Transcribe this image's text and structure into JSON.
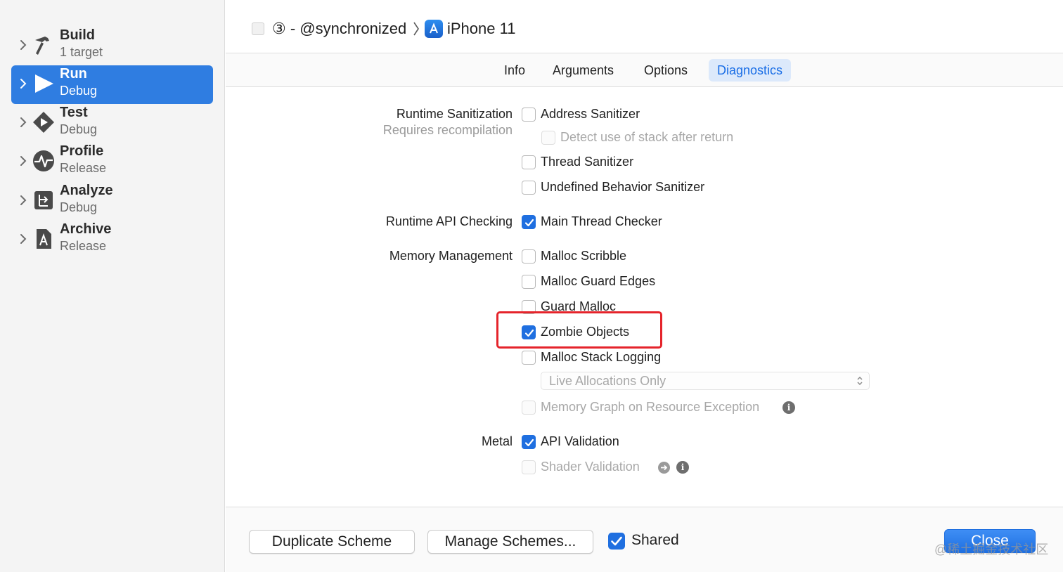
{
  "sidebar": {
    "items": [
      {
        "title": "Build",
        "subtitle": "1 target",
        "icon": "hammer-icon",
        "selected": false
      },
      {
        "title": "Run",
        "subtitle": "Debug",
        "icon": "play-icon",
        "selected": true
      },
      {
        "title": "Test",
        "subtitle": "Debug",
        "icon": "test-diamond-icon",
        "selected": false
      },
      {
        "title": "Profile",
        "subtitle": "Release",
        "icon": "waveform-icon",
        "selected": false
      },
      {
        "title": "Analyze",
        "subtitle": "Debug",
        "icon": "analyze-icon",
        "selected": false
      },
      {
        "title": "Archive",
        "subtitle": "Release",
        "icon": "archive-icon",
        "selected": false
      }
    ]
  },
  "header": {
    "project": "③ - @synchronized",
    "device": "iPhone 11"
  },
  "tabs": [
    {
      "label": "Info",
      "active": false
    },
    {
      "label": "Arguments",
      "active": false
    },
    {
      "label": "Options",
      "active": false
    },
    {
      "label": "Diagnostics",
      "active": true
    }
  ],
  "sections": {
    "runtime_sanitization": {
      "label": "Runtime Sanitization",
      "sublabel": "Requires recompilation",
      "options": [
        {
          "label": "Address Sanitizer",
          "checked": false,
          "disabled": false
        },
        {
          "label": "Detect use of stack after return",
          "checked": false,
          "disabled": true
        },
        {
          "label": "Thread Sanitizer",
          "checked": false,
          "disabled": false
        },
        {
          "label": "Undefined Behavior Sanitizer",
          "checked": false,
          "disabled": false
        }
      ]
    },
    "runtime_api": {
      "label": "Runtime API Checking",
      "options": [
        {
          "label": "Main Thread Checker",
          "checked": true,
          "disabled": false
        }
      ]
    },
    "memory": {
      "label": "Memory Management",
      "options": [
        {
          "label": "Malloc Scribble",
          "checked": false,
          "disabled": false
        },
        {
          "label": "Malloc Guard Edges",
          "checked": false,
          "disabled": false
        },
        {
          "label": "Guard Malloc",
          "checked": false,
          "disabled": false
        },
        {
          "label": "Zombie Objects",
          "checked": true,
          "disabled": false
        },
        {
          "label": "Malloc Stack Logging",
          "checked": false,
          "disabled": false
        }
      ],
      "stack_logging_mode": "Live Allocations Only",
      "memory_graph": {
        "label": "Memory Graph on Resource Exception",
        "checked": false,
        "disabled": true
      }
    },
    "metal": {
      "label": "Metal",
      "options": [
        {
          "label": "API Validation",
          "checked": true,
          "disabled": false
        },
        {
          "label": "Shader Validation",
          "checked": false,
          "disabled": true
        }
      ]
    }
  },
  "footer": {
    "duplicate_label": "Duplicate Scheme",
    "manage_label": "Manage Schemes...",
    "shared_label": "Shared",
    "shared_checked": true,
    "close_label": "Close"
  },
  "watermark": "@稀土掘金技术社区",
  "colors": {
    "accent": "#1f6fe0",
    "selected_row": "#2f7de1",
    "highlight_box": "#e5242b"
  }
}
